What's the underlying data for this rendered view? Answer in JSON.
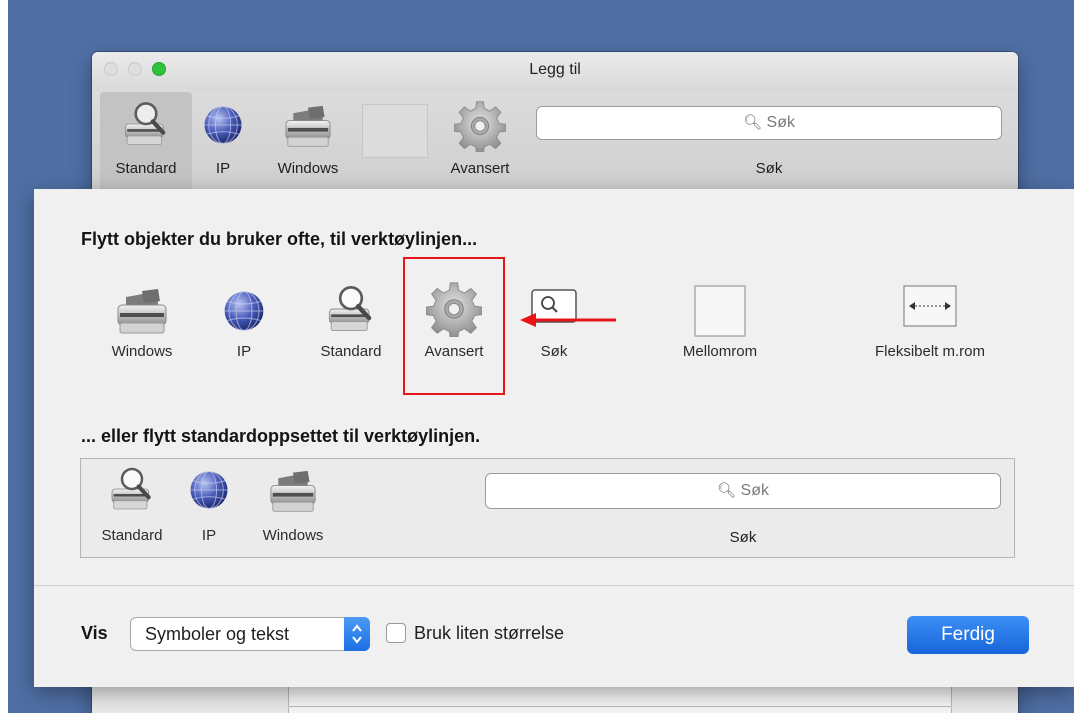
{
  "window": {
    "title": "Legg til",
    "toolbar": {
      "items": [
        {
          "label": "Standard",
          "icon": "standard-magnifier-printer-icon",
          "selected": true
        },
        {
          "label": "IP",
          "icon": "globe-icon"
        },
        {
          "label": "Windows",
          "icon": "printer-icon"
        },
        {
          "label": "Avansert",
          "icon": "gear-icon"
        }
      ],
      "search_placeholder": "Søk",
      "search_label": "Søk"
    }
  },
  "sheet": {
    "palette_heading": "Flytt objekter du bruker ofte, til verktøylinjen...",
    "palette_items": [
      {
        "label": "Windows",
        "icon": "printer-icon"
      },
      {
        "label": "IP",
        "icon": "globe-icon"
      },
      {
        "label": "Standard",
        "icon": "standard-magnifier-printer-icon"
      },
      {
        "label": "Avansert",
        "icon": "gear-icon"
      },
      {
        "label": "Søk",
        "icon": "search-field-icon"
      },
      {
        "label": "Mellomrom",
        "icon": "space-icon"
      },
      {
        "label": "Fleksibelt m.rom",
        "icon": "flexible-space-icon"
      }
    ],
    "default_heading": "... eller flytt standardoppsettet til verktøylinjen.",
    "default_set": {
      "items": [
        {
          "label": "Standard",
          "icon": "standard-magnifier-printer-icon"
        },
        {
          "label": "IP",
          "icon": "globe-icon"
        },
        {
          "label": "Windows",
          "icon": "printer-icon"
        }
      ],
      "search_placeholder": "Søk",
      "search_label": "Søk"
    },
    "footer": {
      "show_label": "Vis",
      "show_select_value": "Symboler og tekst",
      "small_size_label": "Bruk liten størrelse",
      "small_size_checked": false,
      "done_label": "Ferdig"
    }
  },
  "colors": {
    "desktop": "#4f6fa5",
    "annotation_red": "#e8141a",
    "accent_blue": "#1a6fe4"
  }
}
